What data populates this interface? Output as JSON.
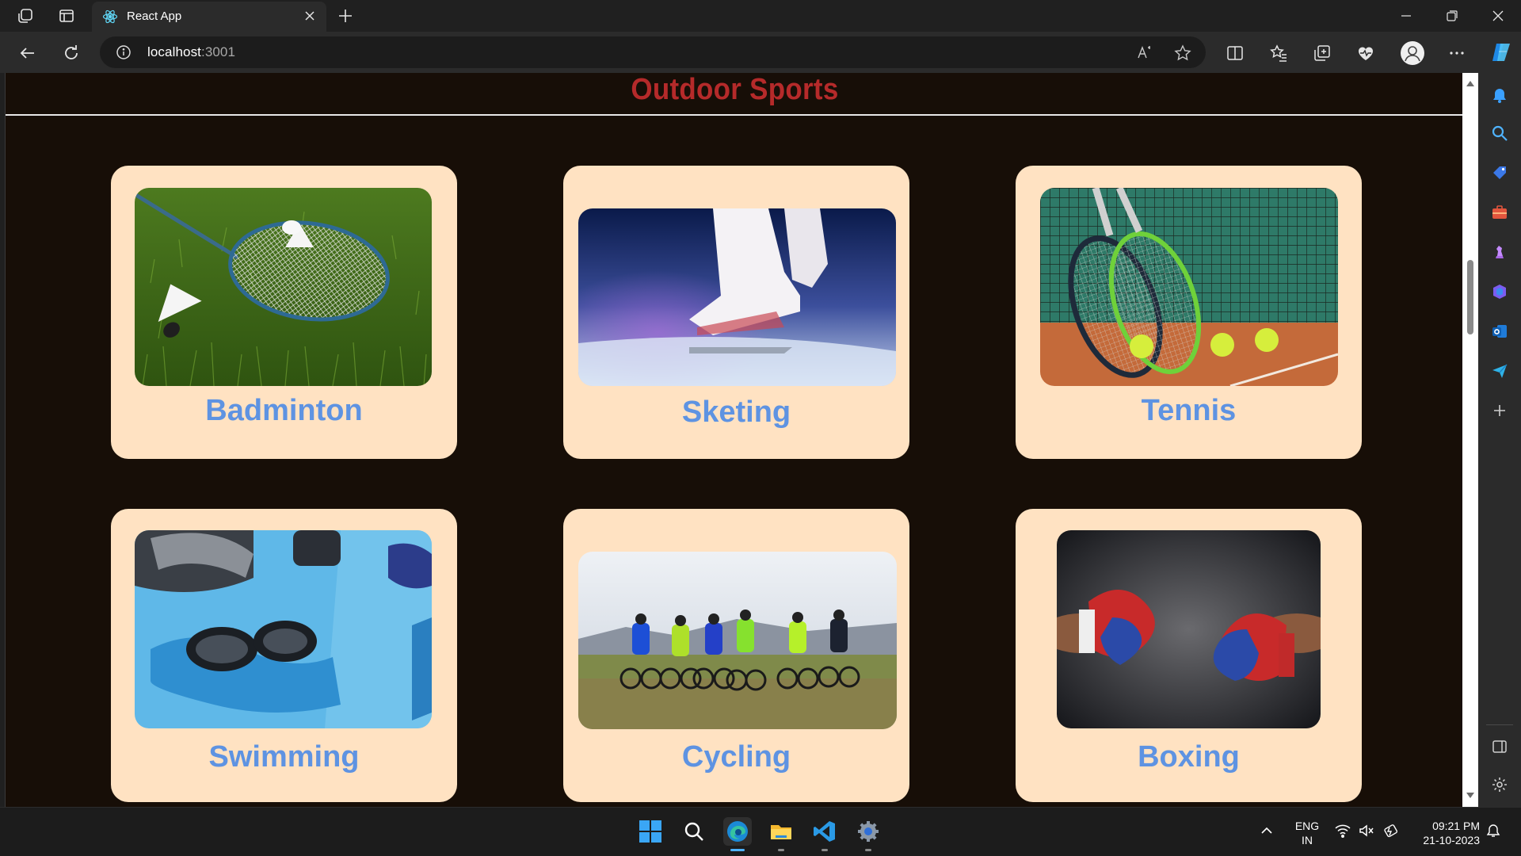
{
  "browser": {
    "tab_title": "React App",
    "url_host": "localhost",
    "url_port": ":3001"
  },
  "page": {
    "title": "Outdoor Sports",
    "title_color": "#b52a2a",
    "label_color": "#5e93e2",
    "card_color": "#ffe2c2",
    "background_color": "#170e07"
  },
  "cards": [
    {
      "label": "Badminton",
      "image": "badminton-image"
    },
    {
      "label": "Sketing",
      "image": "skating-image"
    },
    {
      "label": "Tennis",
      "image": "tennis-image"
    },
    {
      "label": "Swimming",
      "image": "swimming-image"
    },
    {
      "label": "Cycling",
      "image": "cycling-image"
    },
    {
      "label": "Boxing",
      "image": "boxing-image"
    }
  ],
  "taskbar": {
    "lang_line1": "ENG",
    "lang_line2": "IN",
    "time": "09:21 PM",
    "date": "21-10-2023"
  }
}
